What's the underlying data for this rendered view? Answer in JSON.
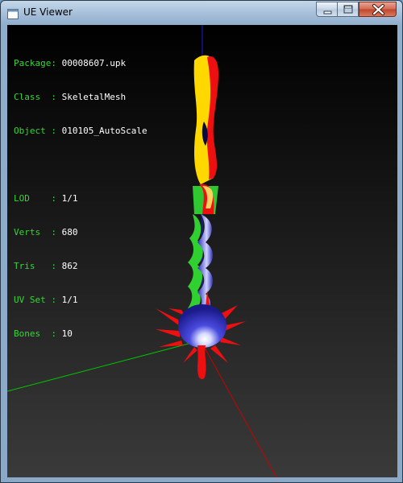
{
  "window": {
    "title": "UE Viewer"
  },
  "info_group1": [
    {
      "key": "Package",
      "value": "00008607.upk"
    },
    {
      "key": "Class  ",
      "value": "SkeletalMesh"
    },
    {
      "key": "Object ",
      "value": "010105_AutoScale"
    }
  ],
  "info_group2": [
    {
      "key": "LOD    ",
      "value": "1/1"
    },
    {
      "key": "Verts  ",
      "value": "680"
    },
    {
      "key": "Tris   ",
      "value": "862"
    },
    {
      "key": "UV Set ",
      "value": "1/1"
    },
    {
      "key": "Bones  ",
      "value": "10"
    }
  ],
  "colors": {
    "label": "#39d439",
    "value": "#ffffff",
    "axis_x": "#cc0000",
    "axis_y": "#00cc00",
    "axis_z": "#0000cc"
  },
  "icons": [
    "app-icon",
    "minimize-icon",
    "maximize-icon",
    "close-icon"
  ]
}
